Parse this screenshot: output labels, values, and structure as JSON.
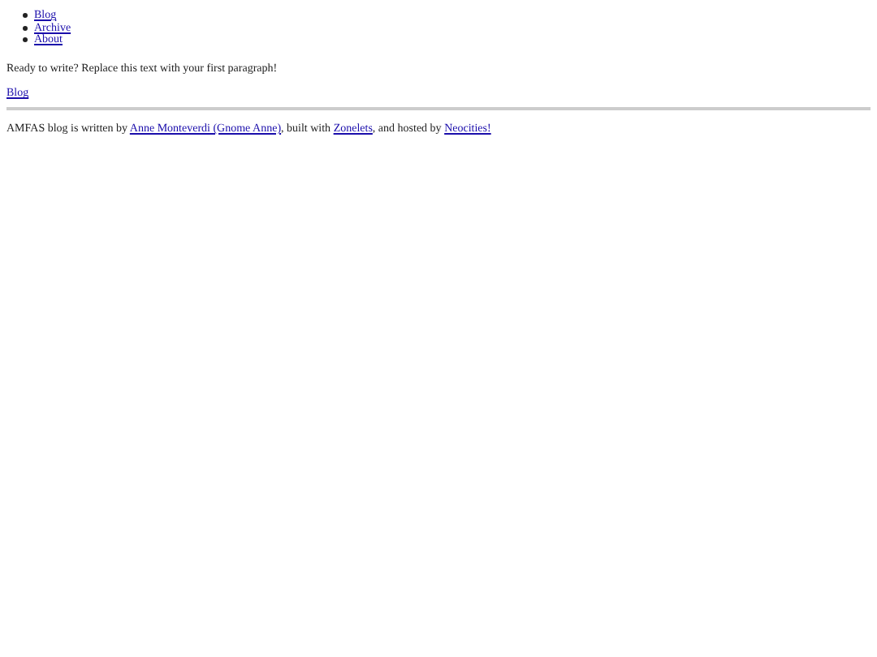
{
  "nav": {
    "items": [
      {
        "label": "Blog"
      },
      {
        "label": "Archive"
      },
      {
        "label": "About"
      }
    ]
  },
  "post": {
    "paragraph": "Ready to write? Replace this text with your first paragraph!",
    "link": "Blog"
  },
  "footer": {
    "parts": [
      {
        "kind": "text",
        "text": "AMFAS blog is written by "
      },
      {
        "kind": "link",
        "text": "Anne Monteverdi (Gnome Anne)"
      },
      {
        "kind": "text",
        "text": ", built with "
      },
      {
        "kind": "link",
        "text": "Zonelets"
      },
      {
        "kind": "text",
        "text": ", and hosted by "
      },
      {
        "kind": "link",
        "text": "Neocities!"
      }
    ]
  }
}
